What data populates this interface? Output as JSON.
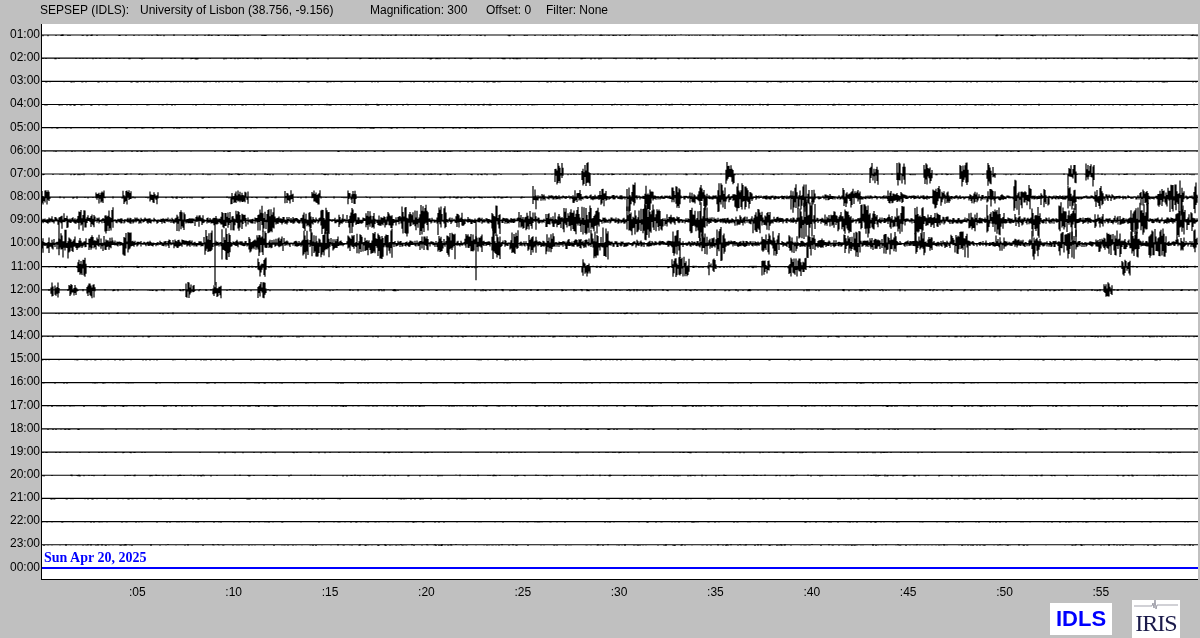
{
  "header": {
    "station": "SEPSEP (IDLS):",
    "location": "University of Lisbon (38.756, -9.156)",
    "magnification": "Magnification: 300",
    "offset": "Offset: 0",
    "filter": "Filter: None"
  },
  "rows": [
    {
      "label": "01:00",
      "current": false
    },
    {
      "label": "02:00",
      "current": false
    },
    {
      "label": "03:00",
      "current": false
    },
    {
      "label": "04:00",
      "current": false
    },
    {
      "label": "05:00",
      "current": false
    },
    {
      "label": "06:00",
      "current": false
    },
    {
      "label": "07:00",
      "current": false
    },
    {
      "label": "08:00",
      "current": false
    },
    {
      "label": "09:00",
      "current": false
    },
    {
      "label": "10:00",
      "current": false
    },
    {
      "label": "11:00",
      "current": false
    },
    {
      "label": "12:00",
      "current": false
    },
    {
      "label": "13:00",
      "current": false
    },
    {
      "label": "14:00",
      "current": false
    },
    {
      "label": "15:00",
      "current": false
    },
    {
      "label": "16:00",
      "current": false
    },
    {
      "label": "17:00",
      "current": false
    },
    {
      "label": "18:00",
      "current": false
    },
    {
      "label": "19:00",
      "current": false
    },
    {
      "label": "20:00",
      "current": false
    },
    {
      "label": "21:00",
      "current": false
    },
    {
      "label": "22:00",
      "current": false
    },
    {
      "label": "23:00",
      "current": false
    },
    {
      "label": "00:00",
      "current": true
    }
  ],
  "date_label": "Sun Apr 20, 2025",
  "minute_ticks": [
    ":05",
    ":10",
    ":15",
    ":20",
    ":25",
    ":30",
    ":35",
    ":40",
    ":45",
    ":50",
    ":55"
  ],
  "logos": {
    "network": "IDLS",
    "iris": "IRIS"
  }
}
